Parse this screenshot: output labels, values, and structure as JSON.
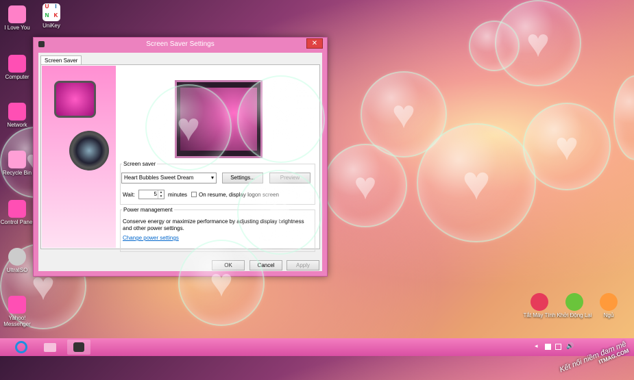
{
  "desktop_left": [
    {
      "label": "I Love You",
      "icon": "love-icon",
      "color": "#ff80c8"
    },
    {
      "label": "UniKey",
      "icon": "unikey-icon",
      "color": "#ffffff"
    },
    {
      "label": "Computer",
      "icon": "computer-icon",
      "color": "#ff4fb4"
    },
    {
      "label": "Network",
      "icon": "network-icon",
      "color": "#ff4fb4"
    },
    {
      "label": "Recycle Bin",
      "icon": "recycle-bin-icon",
      "color": "#ff9fd6"
    },
    {
      "label": "Control Panel",
      "icon": "control-panel-icon",
      "color": "#ff4fb4"
    },
    {
      "label": "UltraISO",
      "icon": "ultraiso-icon",
      "color": "#cccccc"
    },
    {
      "label": "Yahoo! Messenger",
      "icon": "yahoo-messenger-icon",
      "color": "#ff4fb4"
    }
  ],
  "unikey_letters": [
    "U",
    "I",
    "N",
    "K"
  ],
  "desktop_right": [
    {
      "label": "Tắt Máy Tính",
      "icon": "shutdown-icon",
      "color": "#e63b5a"
    },
    {
      "label": "Khởi Động Lại",
      "icon": "restart-icon",
      "color": "#6ac43b"
    },
    {
      "label": "Ngủ",
      "icon": "sleep-icon",
      "color": "#ff9a3b"
    }
  ],
  "window": {
    "title": "Screen Saver Settings",
    "close_glyph": "✕",
    "tab": "Screen Saver",
    "screensaver_group": "Screen saver",
    "selected_screensaver": "Heart Bubbles Sweet Dream",
    "dropdown_arrow": "▾",
    "settings_button": "Settings...",
    "preview_button": "Preview",
    "wait_label": "Wait:",
    "wait_value": "5",
    "minutes_label": "minutes",
    "resume_label": "On resume, display logon screen",
    "power_group": "Power management",
    "power_text_1": "Conserve energy or maximize performance by adjusting display brightness",
    "power_text_2": "and other power settings.",
    "power_link": "Change power settings",
    "ok_button": "OK",
    "cancel_button": "Cancel",
    "apply_button": "Apply"
  },
  "taskbar": {
    "tray_arrow": "◂",
    "tray_volume": "🔊"
  },
  "watermark": {
    "line1": "Kết nối niềm đam mê",
    "line2": "ITMAG.COM"
  },
  "colors": {
    "window_frame": "#ec82bf",
    "taskbar": "#e466b2",
    "link": "#0066cc"
  }
}
